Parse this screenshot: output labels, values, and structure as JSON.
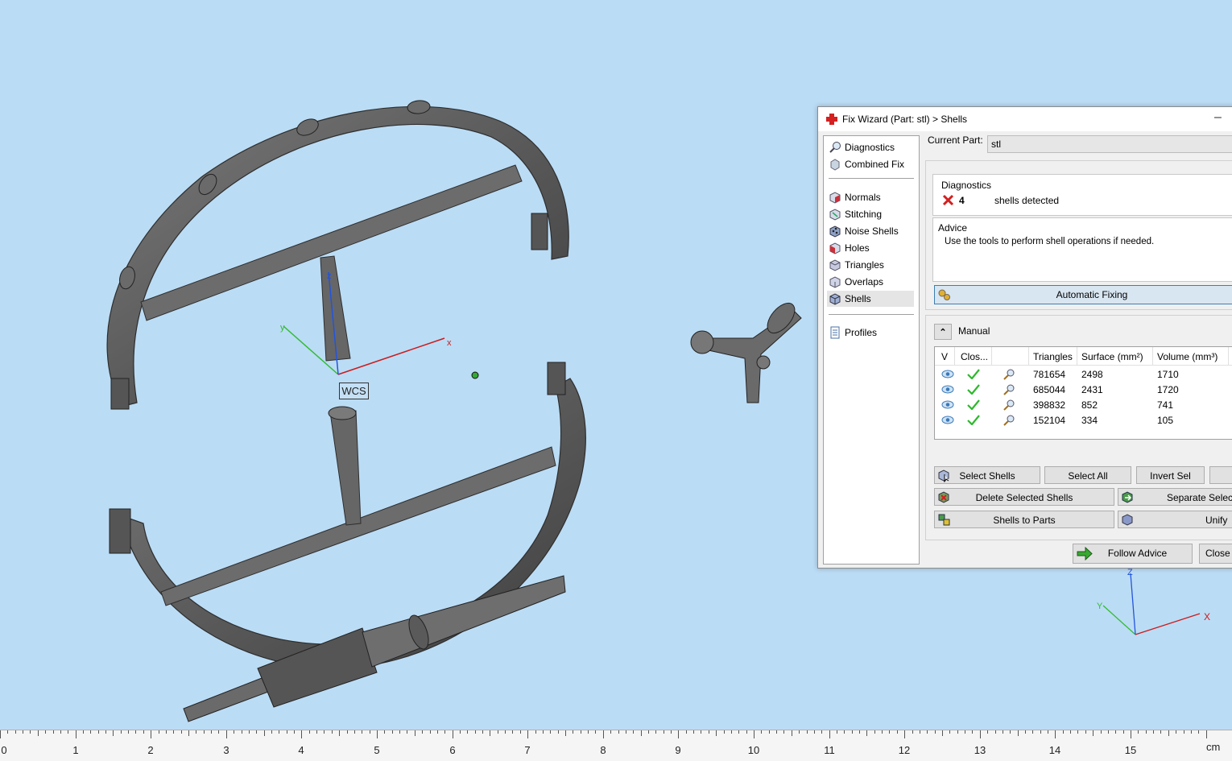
{
  "dialog": {
    "title": "Fix Wizard (Part: stl) > Shells",
    "minimize_label": "–",
    "current_part_label": "Current Part:",
    "current_part_value": "stl"
  },
  "nav": {
    "items": [
      {
        "label": "Diagnostics",
        "icon": "magnifier-icon"
      },
      {
        "label": "Combined Fix",
        "icon": "combined-fix-icon"
      },
      {
        "label": "Normals",
        "icon": "normals-cube-icon"
      },
      {
        "label": "Stitching",
        "icon": "stitching-cube-icon"
      },
      {
        "label": "Noise Shells",
        "icon": "noise-shells-cube-icon"
      },
      {
        "label": "Holes",
        "icon": "holes-cube-icon"
      },
      {
        "label": "Triangles",
        "icon": "triangles-cube-icon"
      },
      {
        "label": "Overlaps",
        "icon": "overlaps-cube-icon"
      },
      {
        "label": "Shells",
        "icon": "shells-cube-icon",
        "active": true
      },
      {
        "label": "Profiles",
        "icon": "profiles-document-icon"
      }
    ]
  },
  "diagnostics": {
    "group_title": "Diagnostics",
    "count": "4",
    "message": "shells detected",
    "status_color": "#d32020"
  },
  "advice": {
    "group_title": "Advice",
    "text": "Use the tools to perform shell operations if needed."
  },
  "automatic_fixing_label": "Automatic Fixing",
  "manual": {
    "title": "Manual",
    "columns": [
      "V",
      "Clos...",
      "",
      "Triangles",
      "Surface (mm²)",
      "Volume (mm³)"
    ],
    "rows": [
      {
        "triangles": "781654",
        "surface": "2498",
        "volume": "1710"
      },
      {
        "triangles": "685044",
        "surface": "2431",
        "volume": "1720"
      },
      {
        "triangles": "398832",
        "surface": "852",
        "volume": "741"
      },
      {
        "triangles": "152104",
        "surface": "334",
        "volume": "105"
      }
    ],
    "buttons": {
      "select_shells": "Select Shells",
      "select_all": "Select All",
      "invert_sel": "Invert Sel",
      "delete_selected": "Delete Selected Shells",
      "separate_selected": "Separate Selecte",
      "shells_to_parts": "Shells to Parts",
      "unify": "Unify"
    }
  },
  "footer": {
    "follow_advice": "Follow Advice",
    "close": "Close"
  },
  "viewport": {
    "wcs_label": "WCS",
    "axis_x": "x",
    "axis_y": "y",
    "axis_z": "z",
    "corner_x": "X",
    "corner_y": "Y",
    "corner_z": "Z",
    "background_color": "#bbdcf5"
  },
  "ruler": {
    "numbers": [
      "0",
      "1",
      "2",
      "3",
      "4",
      "5",
      "6",
      "7",
      "8",
      "9",
      "10",
      "11",
      "12",
      "13",
      "14",
      "15"
    ],
    "unit": "cm"
  }
}
